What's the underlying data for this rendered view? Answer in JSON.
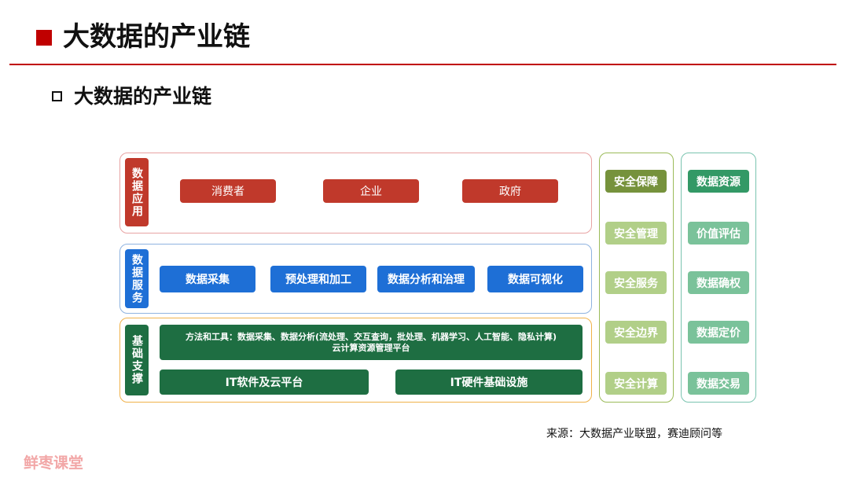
{
  "header": {
    "title": "大数据的产业链",
    "subtitle": "大数据的产业链"
  },
  "diagram": {
    "application": {
      "label": "数据应用",
      "items": [
        "消费者",
        "企业",
        "政府"
      ]
    },
    "service": {
      "label": "数据服务",
      "items": [
        "数据采集",
        "预处理和加工",
        "数据分析和治理",
        "数据可视化"
      ]
    },
    "infrastructure": {
      "label": "基础支撑",
      "tools_line1": "方法和工具：数据采集、数据分析(流处理、交互查询，批处理、机器学习、人工智能、隐私计算)",
      "tools_line2": "云计算资源管理平台",
      "items": [
        "IT软件及云平台",
        "IT硬件基础设施"
      ]
    },
    "security": {
      "items": [
        "安全保障",
        "安全管理",
        "安全服务",
        "安全边界",
        "安全计算"
      ]
    },
    "data_assets": {
      "items": [
        "数据资源",
        "价值评估",
        "数据确权",
        "数据定价",
        "数据交易"
      ]
    }
  },
  "footer": {
    "source": "来源：大数据产业联盟，赛迪顾问等",
    "watermark": "鲜枣课堂"
  },
  "colors": {
    "accent": "#c00000",
    "application": "#c0392b",
    "service": "#1e6fd6",
    "infrastructure": "#1e6e42",
    "security_header": "#76923c",
    "security_item": "#b1cf88",
    "assets_header": "#339966",
    "assets_item": "#7ac29a"
  }
}
